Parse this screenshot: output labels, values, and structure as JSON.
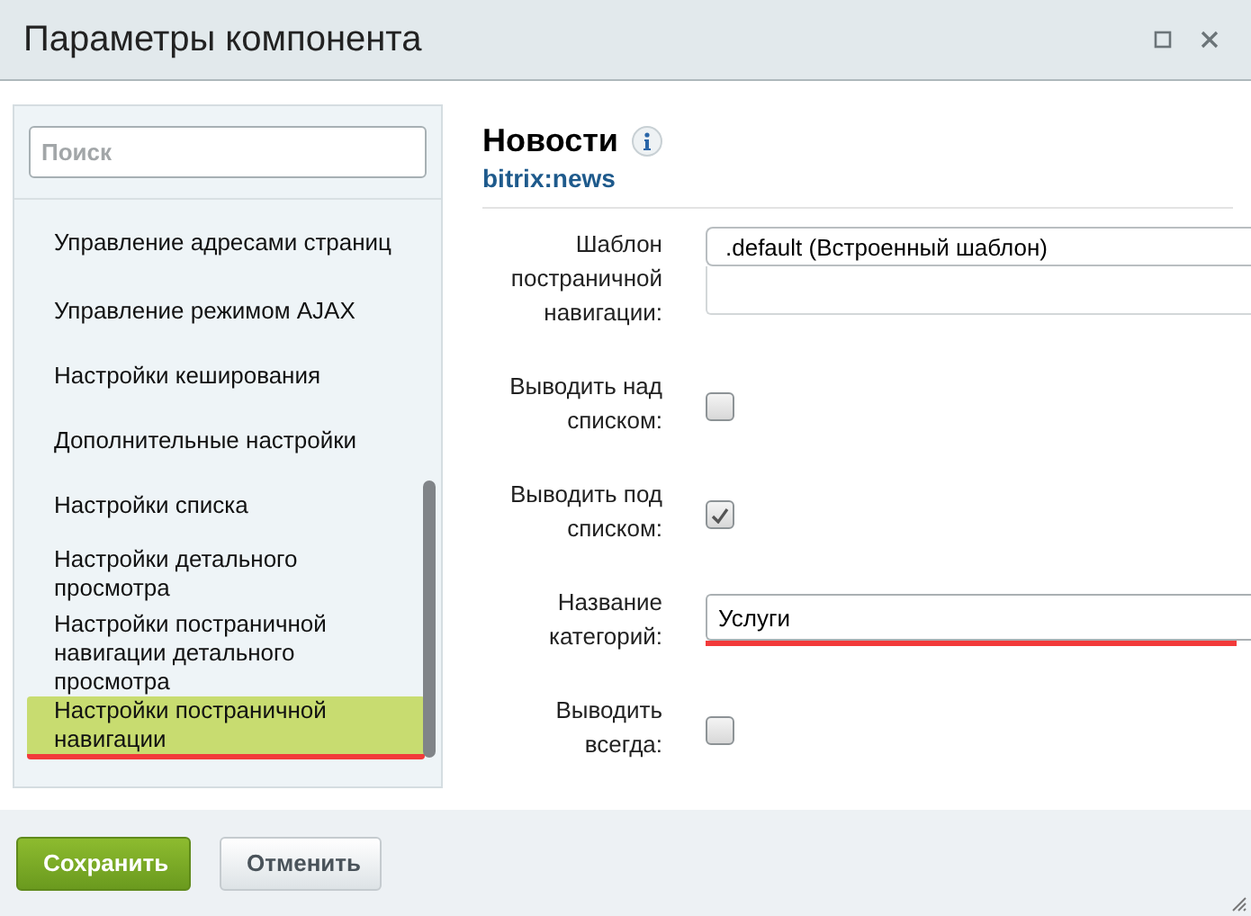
{
  "window": {
    "title": "Параметры компонента"
  },
  "sidebar": {
    "search": {
      "placeholder": "Поиск"
    },
    "items": [
      {
        "label": "Управление адресами страниц",
        "selected": false
      },
      {
        "label": "Управление режимом AJAX",
        "selected": false
      },
      {
        "label": "Настройки кеширования",
        "selected": false
      },
      {
        "label": "Дополнительные настройки",
        "selected": false
      },
      {
        "label": "Настройки списка",
        "selected": false
      },
      {
        "label": "Настройки детального просмотра",
        "selected": false
      },
      {
        "label": "Настройки постраничной навигации детального просмотра",
        "selected": false
      },
      {
        "label": "Настройки постраничной навигации",
        "selected": true
      }
    ]
  },
  "component": {
    "title": "Новости",
    "code": "bitrix:news"
  },
  "fields": [
    {
      "kind": "select",
      "label": "Шаблон постраничной навигации:",
      "value": ".default (Встроенный шаблон)"
    },
    {
      "kind": "checkbox",
      "label": "Выводить над списком:",
      "checked": false
    },
    {
      "kind": "checkbox",
      "label": "Выводить под списком:",
      "checked": true
    },
    {
      "kind": "text",
      "label": "Название категорий:",
      "value": "Услуги"
    },
    {
      "kind": "checkbox",
      "label": "Выводить всегда:",
      "checked": false
    }
  ],
  "buttons": [
    {
      "label": "Сохранить",
      "kind": "primary"
    },
    {
      "label": "Отменить",
      "kind": "secondary"
    }
  ]
}
